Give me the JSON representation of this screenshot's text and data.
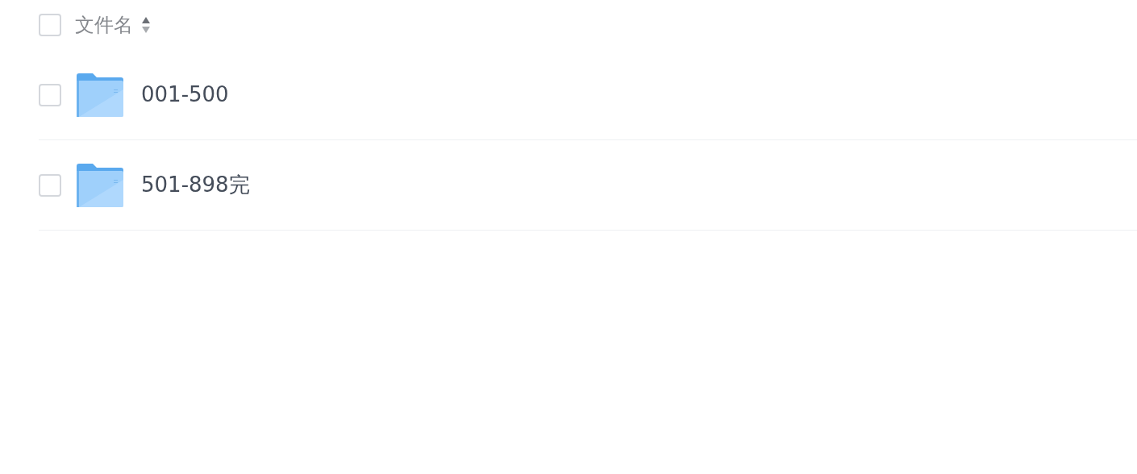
{
  "header": {
    "label": "文件名",
    "checked": false
  },
  "rows": [
    {
      "name": "001-500",
      "checked": false
    },
    {
      "name": "501-898完",
      "checked": false
    }
  ]
}
